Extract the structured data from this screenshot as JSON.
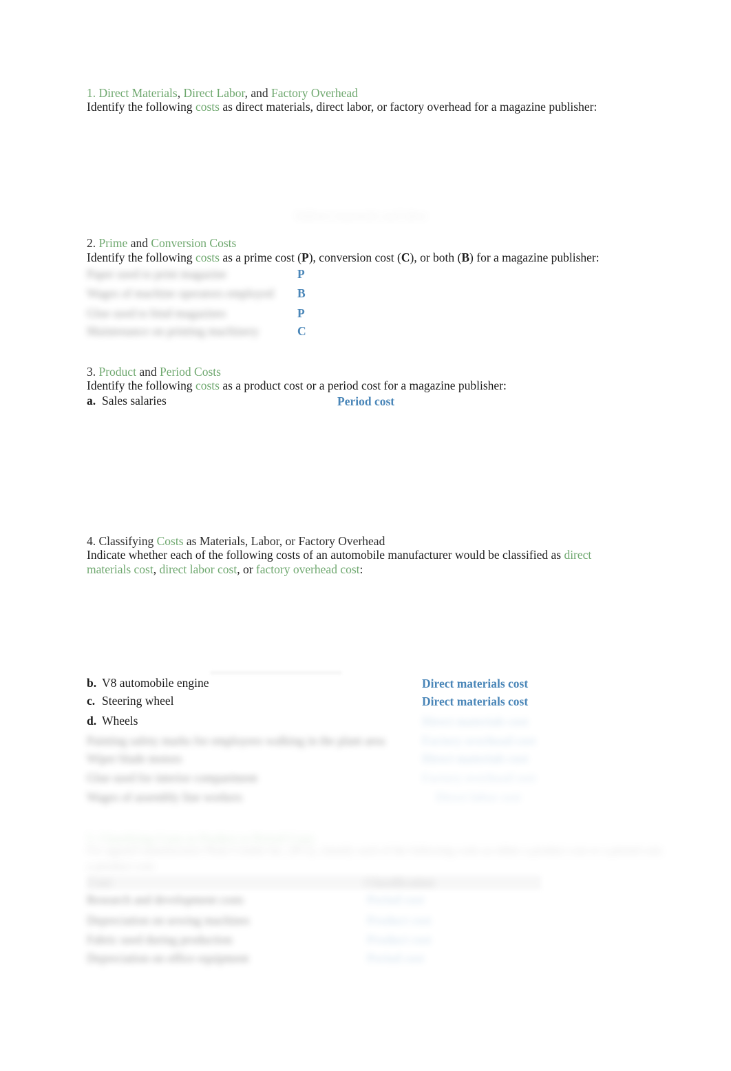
{
  "document": {
    "title": "Cost Classification Worksheet",
    "colors": {
      "heading_green": "#6fa86f",
      "answer_blue": "#4a86b8",
      "body_text": "#1a1a1a"
    }
  },
  "sections": [
    {
      "number": "1.",
      "heading_parts": [
        {
          "text": "1. ",
          "style": "green"
        },
        {
          "text": "Direct Materials",
          "style": "green"
        },
        {
          "text": ", ",
          "style": "plain"
        },
        {
          "text": "Direct Labor",
          "style": "green"
        },
        {
          "text": ", and ",
          "style": "plain"
        },
        {
          "text": "Factory Overhead",
          "style": "green"
        }
      ],
      "heading_plain": "1. Direct Materials, Direct Labor, and Factory Overhead",
      "prompt_parts": [
        {
          "text": "Identify the following ",
          "style": "plain"
        },
        {
          "text": "costs",
          "style": "green"
        },
        {
          "text": " as direct materials, direct labor, or factory overhead for a magazine publisher:",
          "style": "plain"
        }
      ],
      "prompt_plain": "Identify the following costs as direct materials, direct labor, or factory overhead for a magazine publisher:",
      "items_visible": [],
      "items_redacted_note": "content obscured"
    },
    {
      "number": "2.",
      "heading_parts": [
        {
          "text": "2. ",
          "style": "plain"
        },
        {
          "text": "Prime",
          "style": "green"
        },
        {
          "text": " and ",
          "style": "plain"
        },
        {
          "text": "Conversion Costs",
          "style": "green"
        }
      ],
      "heading_plain": "2. Prime and Conversion Costs",
      "prompt_plain": "Identify the following costs as a prime cost (P), conversion cost (C), or both (B) for a magazine publisher:",
      "answers": [
        "P",
        "B",
        "P",
        "C"
      ]
    },
    {
      "number": "3.",
      "heading_parts": [
        {
          "text": "3. ",
          "style": "plain"
        },
        {
          "text": "Product",
          "style": "green"
        },
        {
          "text": " and ",
          "style": "plain"
        },
        {
          "text": "Period Costs",
          "style": "green"
        }
      ],
      "heading_plain": "3. Product and Period Costs",
      "prompt_plain": "Identify the following costs as a product cost or a period cost for a magazine publisher:",
      "items": [
        {
          "marker": "a.",
          "text": "Sales salaries",
          "answer": "Period cost"
        }
      ]
    },
    {
      "number": "4.",
      "heading_parts": [
        {
          "text": "4. Classifying ",
          "style": "plain"
        },
        {
          "text": "Costs",
          "style": "green"
        },
        {
          "text": " as Materials, Labor, or Factory Overhead",
          "style": "plain"
        }
      ],
      "heading_plain": "4. Classifying Costs as Materials, Labor, or Factory Overhead",
      "prompt_plain": "Indicate whether each of the following costs of an automobile manufacturer would be classified as direct materials cost, direct labor cost, or factory overhead cost:",
      "items": [
        {
          "marker": "b.",
          "text": "V8 automobile engine",
          "answer": "Direct materials cost"
        },
        {
          "marker": "c.",
          "text": "Steering wheel",
          "answer": "Direct materials cost"
        },
        {
          "marker": "d.",
          "text": "Wheels",
          "answer": ""
        }
      ]
    },
    {
      "number": "5.",
      "heading_plain": "",
      "prompt_plain": ""
    }
  ],
  "section2_answers": {
    "a": "P",
    "b": "B",
    "c": "P",
    "d": "C"
  },
  "section3": {
    "item_a_marker": "a.",
    "item_a_text": "Sales salaries",
    "item_a_answer": "Period cost"
  },
  "section4": {
    "item_b_marker": "b.",
    "item_b_text": "V8 automobile engine",
    "item_b_answer": "Direct materials cost",
    "item_c_marker": "c.",
    "item_c_text": "Steering wheel",
    "item_c_answer": "Direct materials cost",
    "item_d_marker": "d.",
    "item_d_text": "Wheels"
  },
  "headings": {
    "s1_num": "1. ",
    "s1_a": "Direct Materials",
    "s1_sep1": ", ",
    "s1_b": "Direct Labor",
    "s1_sep2": ", and ",
    "s1_c": "Factory Overhead",
    "s1_p1": "Identify the following ",
    "s1_p2": "costs",
    "s1_p3": " as direct materials, direct labor, or factory overhead for a magazine publisher:",
    "s2_num": "2. ",
    "s2_a": "Prime",
    "s2_sep": " and ",
    "s2_b": "Conversion Costs",
    "s2_p1": "Identify the following ",
    "s2_p2": "costs",
    "s2_p3": " as a prime cost (",
    "s2_P": "P",
    "s2_p4": "), conversion cost (",
    "s2_C": "C",
    "s2_p5": "), or both (",
    "s2_B": "B",
    "s2_p6": ") for a magazine publisher:",
    "s3_num": "3. ",
    "s3_a": "Product",
    "s3_sep": " and ",
    "s3_b": "Period Costs",
    "s3_p1": "Identify the following ",
    "s3_p2": "costs",
    "s3_p3": " as a product cost or a period cost for a magazine publisher:",
    "s4_num": "4. Classifying ",
    "s4_a": "Costs",
    "s4_rest": " as Materials, Labor, or Factory Overhead",
    "s4_p1": "Indicate whether each of the following costs of an automobile manufacturer would be classified as ",
    "s4_p2": "direct materials cost",
    "s4_p3": ", ",
    "s4_p4": "direct labor cost",
    "s4_p5": ", or ",
    "s4_p6": "factory overhead cost",
    "s4_p7": ":"
  },
  "obscured": {
    "s1_block": "Indirect materials and labor",
    "s2_item_a": "Paper used to print magazine",
    "s2_item_b": "Wages of machine operators employed",
    "s2_item_c": "Glue used to bind magazines",
    "s2_item_d": "Maintenance on printing machinery",
    "s4_item_e": "Painting safety marks for employees walking in the plant area",
    "s4_item_f": "Wiper blade motors",
    "s4_item_g": "Glue used for interior compartment",
    "s4_item_h": "Wages of assembly line workers",
    "s4_ans_d": "Direct materials cost",
    "s4_ans_e": "Factory overhead cost",
    "s4_ans_f": "Direct materials cost",
    "s4_ans_g": "Factory overhead cost",
    "s4_ans_h": "Direct labor cost",
    "s5_heading": "5. Classifying Costs as Product or Period Costs",
    "s5_prompt": "For apparel manufacturer Plum Crinkle Inc. (PCI), classify each of the following costs as either a product cost or a period cost:",
    "s5_col_left": "Cost",
    "s5_col_right": "Classification",
    "s5_item_a": "Research and development costs",
    "s5_item_b": "Depreciation on sewing machines",
    "s5_item_c": "Fabric used during production",
    "s5_item_d": "Depreciation on office equipment",
    "s5_ans_a": "Period cost",
    "s5_ans_b": "Product cost",
    "s5_ans_c": "Product cost",
    "s5_ans_d": "Period cost"
  }
}
